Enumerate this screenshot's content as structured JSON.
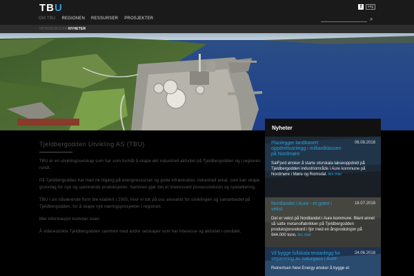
{
  "header": {
    "logo_prefix": "TB",
    "logo_suffix": "U",
    "facebook_icon": "f",
    "lang_label": "eng",
    "nav": [
      "Om TBU",
      "Regionen",
      "Ressurser",
      "Prosjekter"
    ],
    "search_placeholder": "",
    "search_icon": "⌕"
  },
  "subnav": [
    "Introduksjon",
    "Nyheter"
  ],
  "article": {
    "title": "Tjeldbergodden Utvikling AS (TBU)",
    "paragraphs": [
      "TBU er en utviklingsselskap som har som formål å skape økt industriell aktivitet på Tjeldbergodden og i regionen rundt.",
      "På Tjeldbergodden har man rik tilgang på energiressurser og gode infrastruktur, industriell areal, som kan skape grunnlag for nye og spennende produksjoner. Sammen gjør det et interessant prosessindustri og nyetablering.",
      "TBU i sin nåværende form ble etablert i 2005, hvor vi tok på oss ansvaret for utviklingen og samarbeidet på Tjeldbergodden, for å skape nye næringsprosjekter i regionen.",
      "Mer informasjon kommer snart.",
      "Å videreutvikle Tjeldbergodden sammen med andre selskaper som har interesse og aktivitet i området."
    ]
  },
  "news": {
    "heading": "Nyheter",
    "more_label": "les mer",
    "items": [
      {
        "title": "Planlegger landbasert oppdrettsanlegg i milliardklassen på Nordmøre",
        "date": "06.08.2018",
        "text": "SalFjord ønsker å starte storskala lakseoppdrett på Tjeldbergodden industriområde i Aure kommune på Nordmøre i Møre og Romsdal."
      },
      {
        "title": "Nordlandet i Aure - et grønt i vekst",
        "date": "18.07.2018",
        "text": "Det er vekst på Nordlandet i Aure kommune. Blant annet så satte metanolfabrikken på Tjeldbergodden produksjonsrekord i fjor med en årsproduksjon på 944.000 tonn."
      },
      {
        "title": "Vil bygge fullskala testanlegg for separering av naturgass i Aure",
        "date": "24.06.2018",
        "text": "Reinertsen New Energy ønsker å bygge et"
      }
    ]
  },
  "colors": {
    "accent": "#2a9fd8",
    "header_bg": "#1a1a1a",
    "subnav_bg": "#2e2e2e",
    "news_bg": "#222222"
  }
}
